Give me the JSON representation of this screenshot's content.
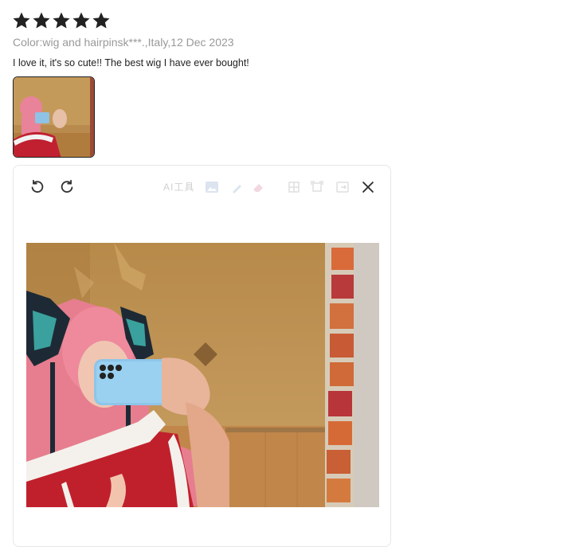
{
  "rating": {
    "stars": 5,
    "max": 5,
    "color": "#222222"
  },
  "review": {
    "meta": "Color:wig and hairpinsk***.,Italy,12 Dec 2023",
    "text": "I love it, it's so cute!! The best wig I have ever bought!"
  },
  "viewer": {
    "toolbar": {
      "rotate_left": "rotate-left-icon",
      "rotate_right": "rotate-right-icon",
      "ai_label": "AI工具",
      "close": "close-icon"
    }
  },
  "colors": {
    "text_dark": "#222222",
    "text_muted": "#999999",
    "border": "#e6e6e6"
  }
}
